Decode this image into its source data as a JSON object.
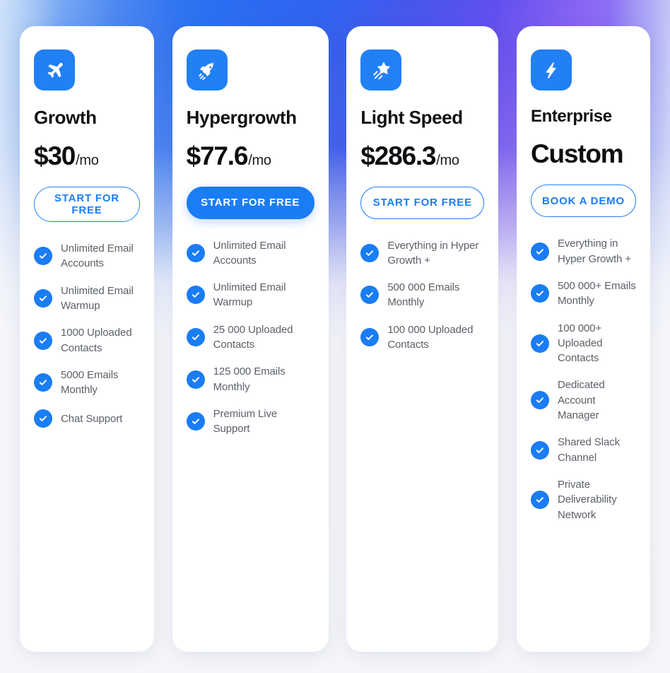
{
  "theme": {
    "accent": "#1a7df5",
    "icon_tile": "#2180f5",
    "page_bg": "#f5f6fa",
    "heading_color": "#101114",
    "feature_text_color": "#5b6069",
    "gradient_from": "#2a6ef2",
    "gradient_to": "#7b4ef2"
  },
  "plans": [
    {
      "id": "growth",
      "icon": "airplane-icon",
      "name": "Growth",
      "price": "$30",
      "price_unit": "/mo",
      "cta_label": "START FOR FREE",
      "cta_style": "outline",
      "features": [
        "Unlimited Email Accounts",
        "Unlimited Email Warmup",
        "1000 Uploaded Contacts",
        "5000 Emails Monthly",
        "Chat Support"
      ]
    },
    {
      "id": "hypergrowth",
      "icon": "rocket-icon",
      "name": "Hypergrowth",
      "price": "$77.6",
      "price_unit": "/mo",
      "cta_label": "START FOR FREE",
      "cta_style": "filled",
      "features": [
        "Unlimited Email Accounts",
        "Unlimited Email Warmup",
        "25 000 Uploaded Contacts",
        "125 000 Emails Monthly",
        "Premium Live Support"
      ]
    },
    {
      "id": "light-speed",
      "icon": "shooting-star-icon",
      "name": "Light Speed",
      "price": "$286.3",
      "price_unit": "/mo",
      "cta_label": "START FOR FREE",
      "cta_style": "outline",
      "features": [
        "Everything in Hyper Growth +",
        "500 000 Emails Monthly",
        "100 000 Uploaded Contacts"
      ]
    },
    {
      "id": "enterprise",
      "icon": "lightning-bolt-icon",
      "name": "Enterprise",
      "price": "Custom",
      "price_unit": "",
      "cta_label": "BOOK A DEMO",
      "cta_style": "outline",
      "features": [
        "Everything in Hyper Growth +",
        "500 000+ Emails Monthly",
        "100 000+ Uploaded Contacts",
        "Dedicated Account Manager",
        "Shared Slack Channel",
        "Private Deliverability Network"
      ]
    }
  ]
}
